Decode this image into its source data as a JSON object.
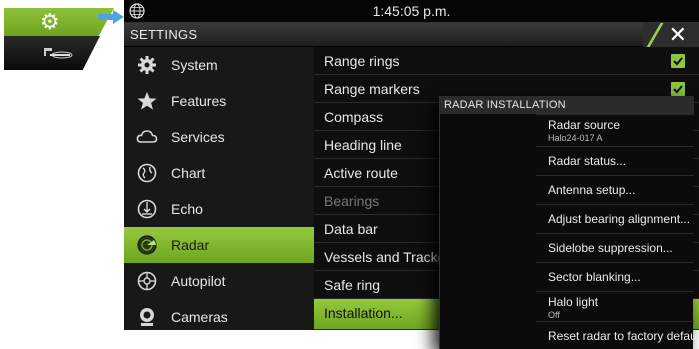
{
  "status": {
    "time": "1:45:05 p.m."
  },
  "window": {
    "title": "SETTINGS"
  },
  "sidebar": {
    "items": [
      {
        "label": "System",
        "icon": "gear-icon"
      },
      {
        "label": "Features",
        "icon": "star-icon"
      },
      {
        "label": "Services",
        "icon": "cloud-icon"
      },
      {
        "label": "Chart",
        "icon": "globe-icon"
      },
      {
        "label": "Echo",
        "icon": "echo-icon"
      },
      {
        "label": "Radar",
        "icon": "radar-icon",
        "active": true
      },
      {
        "label": "Autopilot",
        "icon": "steering-wheel-icon"
      },
      {
        "label": "Cameras",
        "icon": "camera-icon"
      }
    ]
  },
  "options": {
    "items": [
      {
        "label": "Range rings",
        "checked": true
      },
      {
        "label": "Range markers",
        "checked": true
      },
      {
        "label": "Compass"
      },
      {
        "label": "Heading line"
      },
      {
        "label": "Active route"
      },
      {
        "label": "Bearings",
        "disabled": true
      },
      {
        "label": "Data bar"
      },
      {
        "label": "Vessels and Tracked"
      },
      {
        "label": "Safe ring"
      },
      {
        "label": "Installation...",
        "active": true
      }
    ]
  },
  "dialog": {
    "title": "RADAR INSTALLATION",
    "items": [
      {
        "label": "Radar source",
        "sub": "Halo24-017 A"
      },
      {
        "label": "Radar status..."
      },
      {
        "label": "Antenna setup..."
      },
      {
        "label": "Adjust bearing alignment..."
      },
      {
        "label": "Sidelobe suppression..."
      },
      {
        "label": "Sector blanking..."
      },
      {
        "label": "Halo light",
        "sub": "Off"
      },
      {
        "label": "Reset radar to factory defaults..."
      }
    ]
  },
  "colors": {
    "accent": "#8cc63f",
    "background": "#111111",
    "text": "#e8e8e8"
  }
}
